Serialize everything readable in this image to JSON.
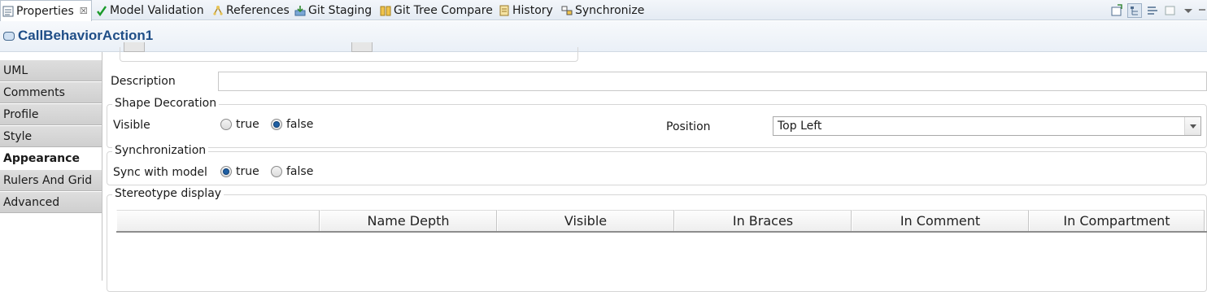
{
  "tabs": [
    {
      "label": "Properties",
      "icon": "properties-icon",
      "active": true,
      "close": "☒"
    },
    {
      "label": "Model Validation",
      "icon": "checkmark-icon"
    },
    {
      "label": "References",
      "icon": "references-icon"
    },
    {
      "label": "Git Staging",
      "icon": "git-staging-icon"
    },
    {
      "label": "Git Tree Compare",
      "icon": "git-tree-compare-icon"
    },
    {
      "label": "History",
      "icon": "history-icon"
    },
    {
      "label": "Synchronize",
      "icon": "synchronize-icon"
    }
  ],
  "header": {
    "title": "CallBehaviorAction1"
  },
  "sidebar": {
    "items": [
      {
        "label": "UML"
      },
      {
        "label": "Comments"
      },
      {
        "label": "Profile"
      },
      {
        "label": "Style"
      },
      {
        "label": "Appearance",
        "active": true
      },
      {
        "label": "Rulers And Grid"
      },
      {
        "label": "Advanced"
      }
    ]
  },
  "description": {
    "label": "Description",
    "value": ""
  },
  "shape_decoration": {
    "title": "Shape Decoration",
    "visible_label": "Visible",
    "true_label": "true",
    "false_label": "false",
    "selected": "false",
    "position_label": "Position",
    "position_value": "Top Left"
  },
  "synchronization": {
    "title": "Synchronization",
    "sync_label": "Sync with model",
    "true_label": "true",
    "false_label": "false",
    "selected": "true"
  },
  "stereotype_display": {
    "title": "Stereotype display",
    "columns": [
      "",
      "Name Depth",
      "Visible",
      "In Braces",
      "In Comment",
      "In Compartment"
    ]
  },
  "colors": {
    "title_text": "#1f4e87",
    "radio_selected": "#1f5fa3",
    "active_check": "#1a9a2a"
  }
}
